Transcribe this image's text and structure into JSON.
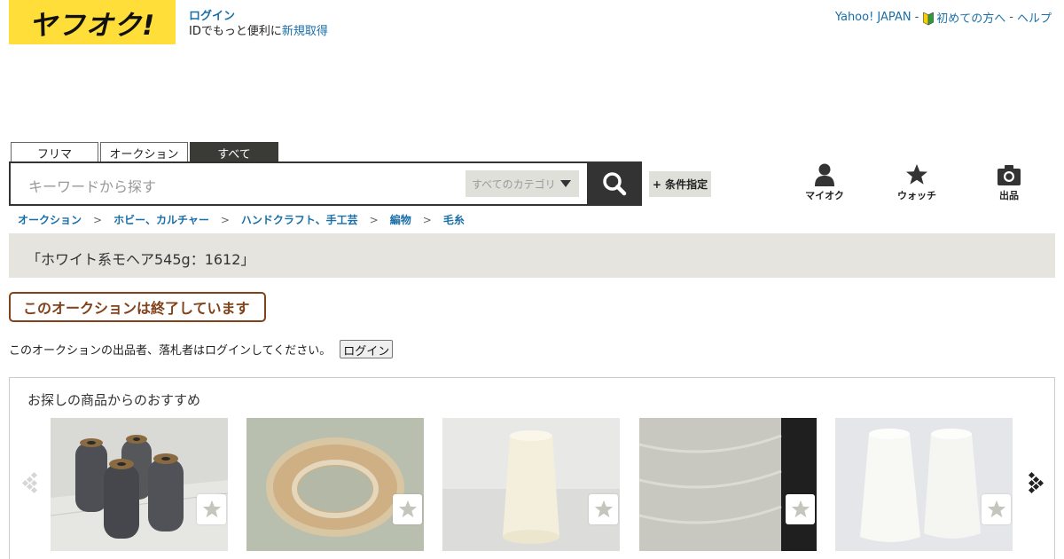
{
  "header": {
    "logo_text": "ヤフオク!",
    "login_label": "ログイン",
    "id_prompt": "IDでもっと便利に",
    "signup_label": "新規取得",
    "yahoo_japan": "Yahoo! JAPAN",
    "beginner": "初めての方へ",
    "help": "ヘルプ",
    "separator": "-"
  },
  "tabs": [
    {
      "label": "フリマ"
    },
    {
      "label": "オークション"
    },
    {
      "label": "すべて",
      "selected": true
    }
  ],
  "search": {
    "placeholder": "キーワードから探す",
    "category": "すべてのカテゴリ",
    "conditions_label": "+ 条件指定"
  },
  "nav": {
    "myauc": "マイオク",
    "watch": "ウォッチ",
    "sell": "出品"
  },
  "breadcrumb": [
    {
      "label": "オークション"
    },
    {
      "label": "ホビー、カルチャー"
    },
    {
      "label": "ハンドクラフト、手工芸"
    },
    {
      "label": "編物"
    },
    {
      "label": "毛糸"
    }
  ],
  "breadcrumb_sep": ">",
  "item": {
    "title": "「ホワイト系モヘア545g：1612」",
    "ended_label": "このオークションは終了しています",
    "login_message": "このオークションの出品者、落札者はログインしてください。",
    "login_button": "ログイン"
  },
  "recommend": {
    "title": "お探しの商品からのおすすめ",
    "items": [
      {
        "image": "gray-yarn-cones"
      },
      {
        "image": "crochet-scrunchie"
      },
      {
        "image": "white-mohair-cone"
      },
      {
        "image": "mohair-closeup"
      },
      {
        "image": "two-white-cones"
      }
    ]
  },
  "colors": {
    "brand_yellow": "#ffde3a",
    "link_blue": "#1a6fa8",
    "ended_brown": "#80421a",
    "dark": "#333333"
  }
}
